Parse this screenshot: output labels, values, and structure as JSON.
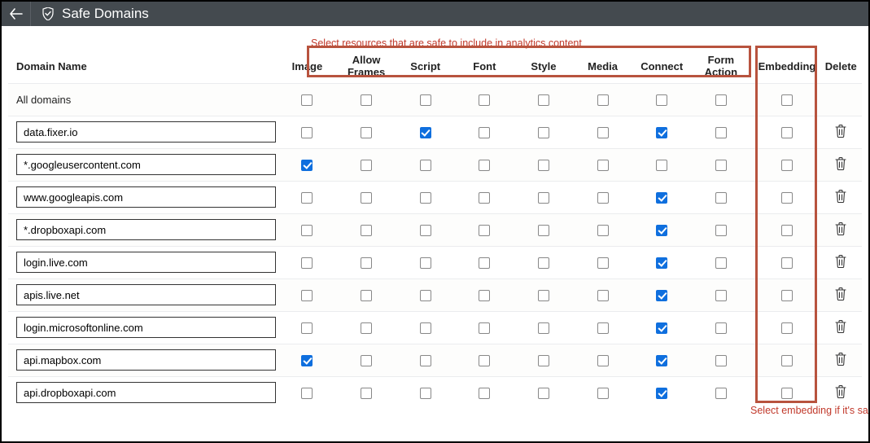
{
  "header": {
    "title": "Safe Domains"
  },
  "annotations": {
    "top": "Select resources that are safe to include in analytics content",
    "bottom": "Select embedding if it's safe to embed analytics content in the domain"
  },
  "columns": {
    "name": "Domain Name",
    "image": "Image",
    "allow_frames": "Allow Frames",
    "script": "Script",
    "font": "Font",
    "style": "Style",
    "media": "Media",
    "connect": "Connect",
    "form_action": "Form Action",
    "embedding": "Embedding",
    "delete": "Delete"
  },
  "rows": [
    {
      "name": "All domains",
      "editable": false,
      "deletable": false,
      "image": false,
      "frames": false,
      "script": false,
      "font": false,
      "style": false,
      "media": false,
      "connect": false,
      "form": false,
      "embedding": false
    },
    {
      "name": "data.fixer.io",
      "editable": true,
      "deletable": true,
      "image": false,
      "frames": false,
      "script": true,
      "font": false,
      "style": false,
      "media": false,
      "connect": true,
      "form": false,
      "embedding": false
    },
    {
      "name": "*.googleusercontent.com",
      "editable": true,
      "deletable": true,
      "image": true,
      "frames": false,
      "script": false,
      "font": false,
      "style": false,
      "media": false,
      "connect": false,
      "form": false,
      "embedding": false
    },
    {
      "name": "www.googleapis.com",
      "editable": true,
      "deletable": true,
      "image": false,
      "frames": false,
      "script": false,
      "font": false,
      "style": false,
      "media": false,
      "connect": true,
      "form": false,
      "embedding": false
    },
    {
      "name": "*.dropboxapi.com",
      "editable": true,
      "deletable": true,
      "image": false,
      "frames": false,
      "script": false,
      "font": false,
      "style": false,
      "media": false,
      "connect": true,
      "form": false,
      "embedding": false
    },
    {
      "name": "login.live.com",
      "editable": true,
      "deletable": true,
      "image": false,
      "frames": false,
      "script": false,
      "font": false,
      "style": false,
      "media": false,
      "connect": true,
      "form": false,
      "embedding": false
    },
    {
      "name": "apis.live.net",
      "editable": true,
      "deletable": true,
      "image": false,
      "frames": false,
      "script": false,
      "font": false,
      "style": false,
      "media": false,
      "connect": true,
      "form": false,
      "embedding": false
    },
    {
      "name": "login.microsoftonline.com",
      "editable": true,
      "deletable": true,
      "image": false,
      "frames": false,
      "script": false,
      "font": false,
      "style": false,
      "media": false,
      "connect": true,
      "form": false,
      "embedding": false
    },
    {
      "name": "api.mapbox.com",
      "editable": true,
      "deletable": true,
      "image": true,
      "frames": false,
      "script": false,
      "font": false,
      "style": false,
      "media": false,
      "connect": true,
      "form": false,
      "embedding": false
    },
    {
      "name": "api.dropboxapi.com",
      "editable": true,
      "deletable": true,
      "image": false,
      "frames": false,
      "script": false,
      "font": false,
      "style": false,
      "media": false,
      "connect": true,
      "form": false,
      "embedding": false
    }
  ]
}
